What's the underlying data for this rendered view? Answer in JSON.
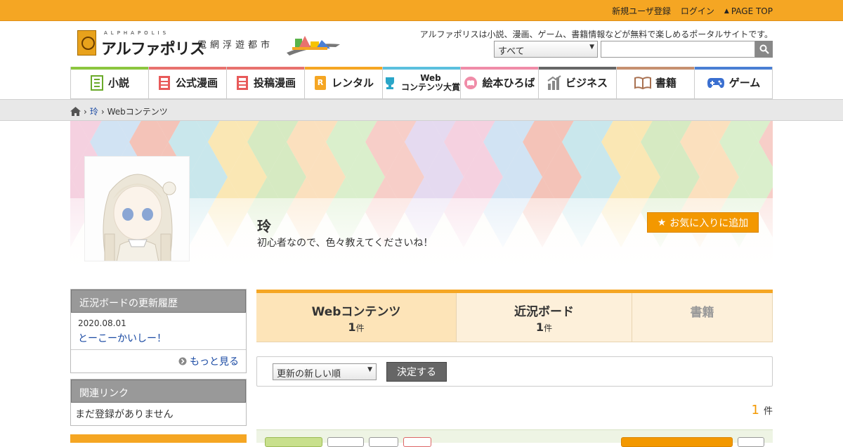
{
  "topbar": {
    "new_user": "新規ユーザ登録",
    "login": "ログイン",
    "page_top": "PAGE TOP"
  },
  "logo": {
    "alpha": "ALPHAPOLIS",
    "name": "アルファポリス",
    "sub": "電網浮遊都市"
  },
  "header": {
    "tagline": "アルファポリスは小説、漫画、ゲーム、書籍情報などが無料で楽しめるポータルサイトです。",
    "search_select": "すべて",
    "search_value": ""
  },
  "nav": {
    "items": [
      {
        "label": "小説",
        "icon": "novel-icon",
        "color": "#8cc63f"
      },
      {
        "label": "公式漫画",
        "icon": "manga-icon",
        "color": "#e8726e"
      },
      {
        "label": "投稿漫画",
        "icon": "manga-icon",
        "color": "#e8726e"
      },
      {
        "label": "レンタル",
        "icon": "rental-icon",
        "color": "#f5a623"
      },
      {
        "label": "Web",
        "label2": "コンテンツ大賞",
        "icon": "trophy-icon",
        "color": "#5bc0de"
      },
      {
        "label": "絵本ひろば",
        "icon": "picturebook-icon",
        "color": "#f08ca8"
      },
      {
        "label": "ビジネス",
        "icon": "business-icon",
        "color": "#666666"
      },
      {
        "label": "書籍",
        "icon": "book-icon",
        "color": "#c69070"
      },
      {
        "label": "ゲーム",
        "icon": "game-icon",
        "color": "#4a7fd4"
      }
    ]
  },
  "breadcrumb": {
    "user": "玲",
    "current": "Webコンテンツ"
  },
  "profile": {
    "name": "玲",
    "description": "初心者なので、色々教えてくださいね！",
    "favorite_label": "お気に入りに追加"
  },
  "sidebar": {
    "board_title": "近況ボードの更新履歴",
    "board_date": "2020.08.01",
    "board_link": "とーこーかいしー！",
    "more_label": "もっと見る",
    "links_title": "関連リンク",
    "links_empty": "まだ登録がありません"
  },
  "tabs": [
    {
      "label": "Webコンテンツ",
      "count": "1",
      "unit": "件"
    },
    {
      "label": "近況ボード",
      "count": "1",
      "unit": "件"
    },
    {
      "label": "書籍"
    }
  ],
  "sort": {
    "selected": "更新の新しい順",
    "button": "決定する"
  },
  "result": {
    "count": "1",
    "unit": "件"
  },
  "colors": {
    "accent": "#f5a623",
    "fav": "#f39800",
    "link": "#1a4aa3"
  }
}
